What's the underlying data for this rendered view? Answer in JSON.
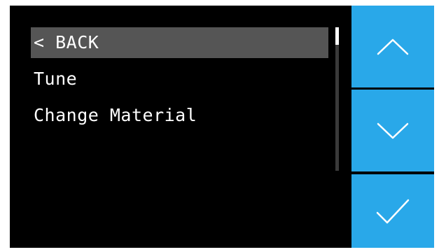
{
  "menu": {
    "items": [
      {
        "label": "< BACK",
        "selected": true
      },
      {
        "label": "Tune",
        "selected": false
      },
      {
        "label": "Change Material",
        "selected": false
      }
    ]
  },
  "controls": {
    "up_icon": "chevron-up-icon",
    "down_icon": "chevron-down-icon",
    "confirm_icon": "checkmark-icon"
  },
  "colors": {
    "screen_background": "#000000",
    "selection_highlight": "#555555",
    "menu_text": "#ffffff",
    "button_background": "#29a8e9",
    "button_icon": "#ffffff"
  }
}
